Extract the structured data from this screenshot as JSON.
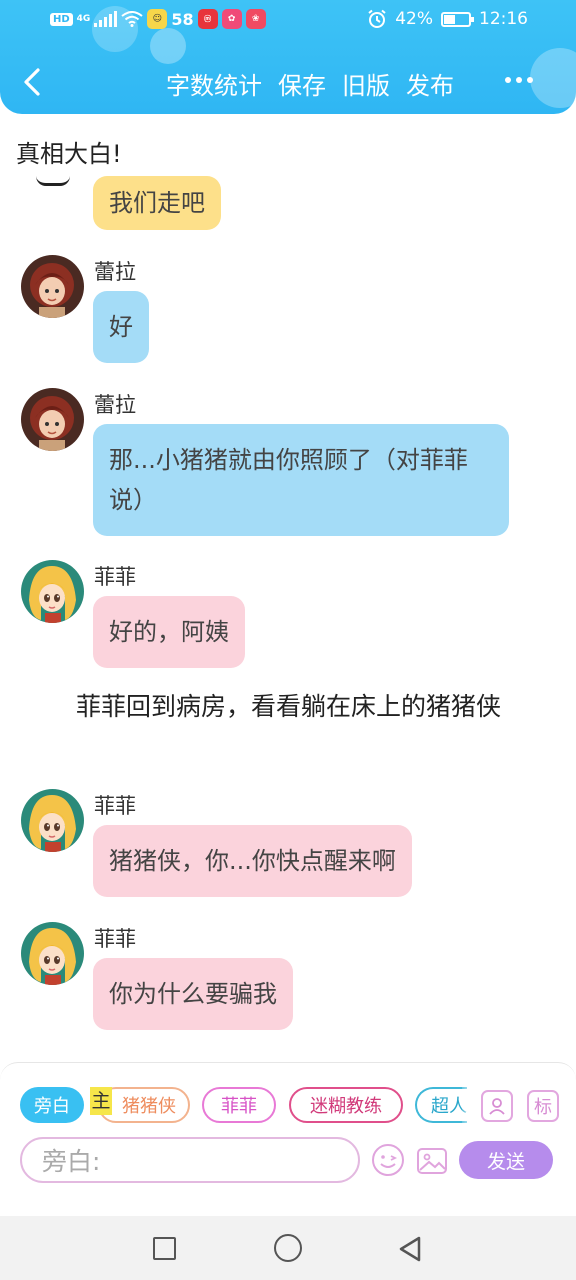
{
  "status_bar": {
    "hd": "HD",
    "network": "4G",
    "app_58": "58",
    "battery": "42%",
    "time": "12:16"
  },
  "header": {
    "actions": [
      "字数统计",
      "保存",
      "旧版",
      "发布"
    ]
  },
  "story": {
    "title": "真相大白!",
    "messages": [
      {
        "speaker": "",
        "text": "我们走吧"
      },
      {
        "speaker": "蕾拉",
        "text": "好"
      },
      {
        "speaker": "蕾拉",
        "text": "那...小猪猪就由你照顾了（对菲菲说）"
      },
      {
        "speaker": "菲菲",
        "text": "好的，阿姨"
      },
      {
        "speaker": "菲菲",
        "text": "猪猪侠，你...你快点醒来啊"
      },
      {
        "speaker": "菲菲",
        "text": "你为什么要骗我"
      }
    ],
    "narration": "菲菲回到病房，看看躺在床上的猪猪侠"
  },
  "composer": {
    "roles": {
      "narrator": "旁白",
      "main_tag": "主",
      "pig": "猪猪侠",
      "fei": "菲菲",
      "coach": "迷糊教练",
      "super": "超人"
    },
    "tag_button": "标",
    "input_placeholder": "旁白:",
    "send": "发送"
  },
  "colors": {
    "header_blue": "#2fb6f3",
    "blue_bubble": "#a4dcf7",
    "pink_bubble": "#fbd3dc",
    "yellow_bubble": "#fde08a",
    "send_purple": "#b68cec"
  }
}
